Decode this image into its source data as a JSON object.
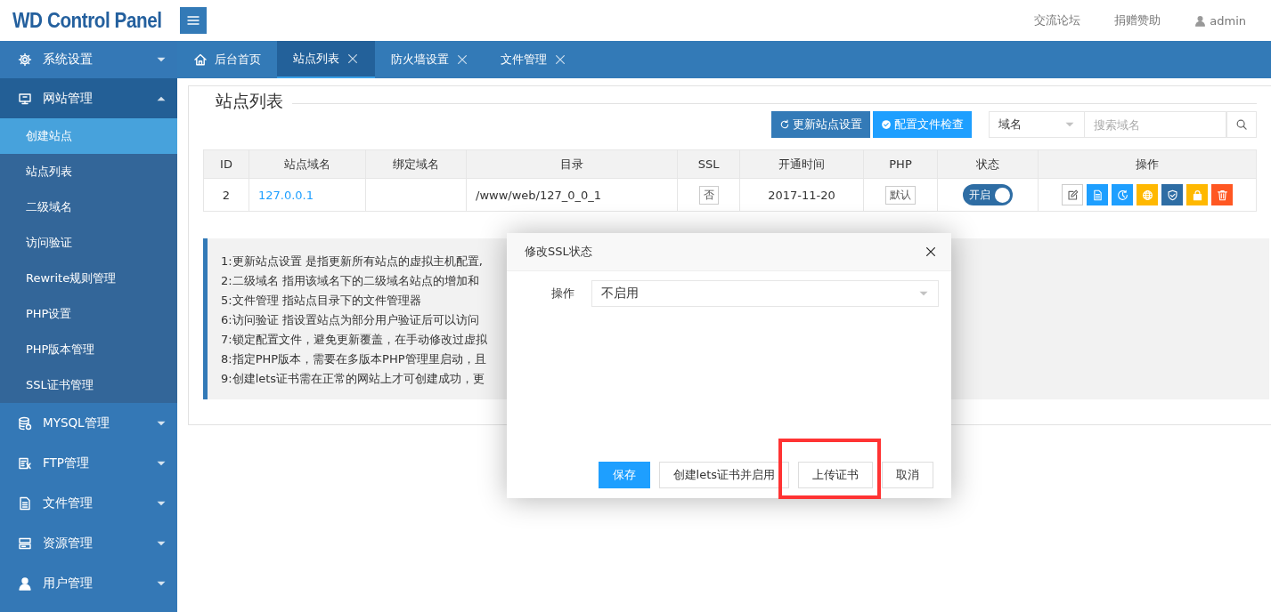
{
  "header": {
    "logo": "WD Control Panel",
    "links": [
      "交流论坛",
      "捐赠赞助"
    ],
    "user": "admin"
  },
  "sidebar": {
    "groups": [
      {
        "label": "系统设置",
        "expanded": false
      },
      {
        "label": "网站管理",
        "expanded": true,
        "children": [
          {
            "label": "创建站点",
            "selected": true
          },
          {
            "label": "站点列表",
            "selected": false
          },
          {
            "label": "二级域名",
            "selected": false
          },
          {
            "label": "访问验证",
            "selected": false
          },
          {
            "label": "Rewrite规则管理",
            "selected": false
          },
          {
            "label": "PHP设置",
            "selected": false
          },
          {
            "label": "PHP版本管理",
            "selected": false
          },
          {
            "label": "SSL证书管理",
            "selected": false
          }
        ]
      },
      {
        "label": "MYSQL管理",
        "expanded": false
      },
      {
        "label": "FTP管理",
        "expanded": false
      },
      {
        "label": "文件管理",
        "expanded": false
      },
      {
        "label": "资源管理",
        "expanded": false
      },
      {
        "label": "用户管理",
        "expanded": false
      }
    ]
  },
  "tabs": [
    {
      "label": "后台首页",
      "selected": false,
      "closable": false
    },
    {
      "label": "站点列表",
      "selected": true,
      "closable": true
    },
    {
      "label": "防火墙设置",
      "selected": false,
      "closable": true
    },
    {
      "label": "文件管理",
      "selected": false,
      "closable": true
    }
  ],
  "panel": {
    "title": "站点列表",
    "toolbar": [
      {
        "label": "更新站点设置",
        "kind": "primary"
      },
      {
        "label": "配置文件检查",
        "kind": "normal"
      }
    ],
    "search": {
      "field": "域名",
      "placeholder": "搜索域名"
    },
    "table": {
      "columns": [
        "ID",
        "站点域名",
        "绑定域名",
        "目录",
        "SSL",
        "开通时间",
        "PHP",
        "状态",
        "操作"
      ],
      "rows": [
        {
          "id": "2",
          "domain": "127.0.0.1",
          "directory": "/www/web/127_0_0_1",
          "ssl": "否",
          "created": "2017-11-20",
          "php": "默认",
          "status": "开启",
          "status_on": true,
          "actions": [
            {
              "color": "#ffffff"
            },
            {
              "color": "#1e9fff"
            },
            {
              "color": "#1e9fff"
            },
            {
              "color": "#ffb800"
            },
            {
              "color": "#2e6da4"
            },
            {
              "color": "#ffb800"
            },
            {
              "color": "#ff5722"
            }
          ]
        }
      ]
    },
    "tips": [
      "1:更新站点设置 是指更新所有站点的虚拟主机配置,",
      "2:二级域名 指用该域名下的二级域名站点的增加和",
      "5:文件管理 指站点目录下的文件管理器",
      "6:访问验证 指设置站点为部分用户验证后可以访问",
      "7:锁定配置文件，避免更新覆盖，在手动修改过虚拟",
      "8:指定PHP版本，需要在多版本PHP管理里启动，且",
      "9:创建lets证书需在正常的网站上才可创建成功，更"
    ]
  },
  "dialog": {
    "title": "修改SSL状态",
    "field_label": "操作",
    "field_value": "不启用",
    "buttons": [
      {
        "label": "保存",
        "kind": "primary"
      },
      {
        "label": "创建lets证书并启用",
        "kind": "default"
      },
      {
        "label": "上传证书",
        "kind": "default",
        "highlighted": true
      },
      {
        "label": "取消",
        "kind": "default"
      }
    ]
  }
}
